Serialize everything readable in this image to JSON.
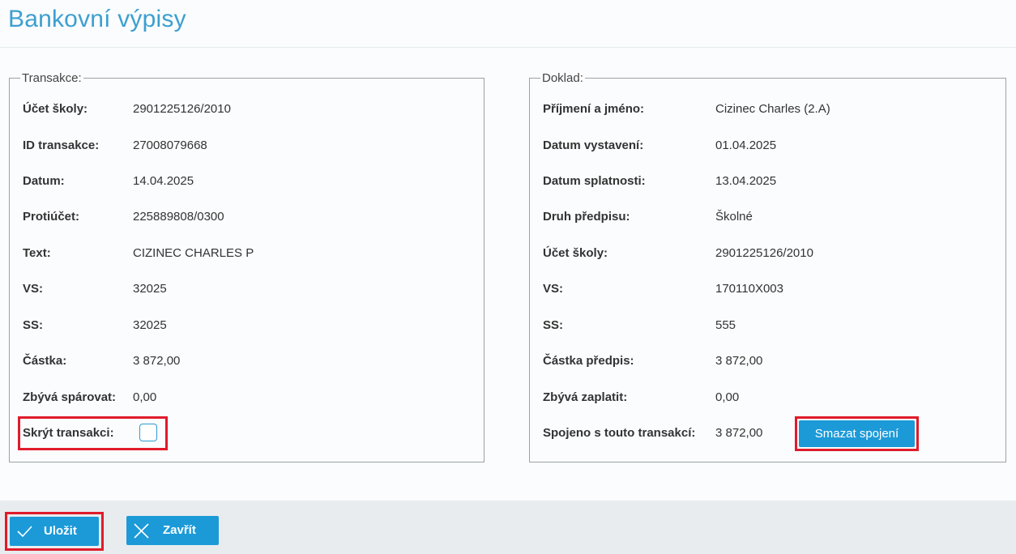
{
  "page_title": "Bankovní výpisy",
  "transaction": {
    "legend": "Transakce:",
    "rows": [
      {
        "label": "Účet školy:",
        "value": "2901225126/2010"
      },
      {
        "label": "ID transakce:",
        "value": "27008079668"
      },
      {
        "label": "Datum:",
        "value": "14.04.2025"
      },
      {
        "label": "Protiúčet:",
        "value": "225889808/0300"
      },
      {
        "label": "Text:",
        "value": "CIZINEC CHARLES P"
      },
      {
        "label": "VS:",
        "value": "32025"
      },
      {
        "label": "SS:",
        "value": "32025"
      },
      {
        "label": "Částka:",
        "value": "3 872,00"
      },
      {
        "label": "Zbývá spárovat:",
        "value": "0,00"
      }
    ],
    "hide_label": "Skrýt transakci:",
    "hide_checked": false
  },
  "document": {
    "legend": "Doklad:",
    "rows": [
      {
        "label": "Příjmení a jméno:",
        "value": "Cizinec Charles (2.A)"
      },
      {
        "label": "Datum vystavení:",
        "value": "01.04.2025"
      },
      {
        "label": "Datum splatnosti:",
        "value": "13.04.2025"
      },
      {
        "label": "Druh předpisu:",
        "value": "Školné"
      },
      {
        "label": "Účet školy:",
        "value": "2901225126/2010"
      },
      {
        "label": "VS:",
        "value": "170110X003"
      },
      {
        "label": "SS:",
        "value": "555"
      },
      {
        "label": "Částka předpis:",
        "value": "3 872,00"
      },
      {
        "label": "Zbývá zaplatit:",
        "value": "0,00"
      }
    ],
    "linked_label": "Spojeno s touto transakcí:",
    "linked_value": "3 872,00",
    "unlink_button": "Smazat spojení"
  },
  "footer": {
    "save_label": "Uložit",
    "close_label": "Zavřít"
  },
  "colors": {
    "accent": "#1c9ad8",
    "highlight": "#e01b2b",
    "title": "#3d9fd0"
  }
}
